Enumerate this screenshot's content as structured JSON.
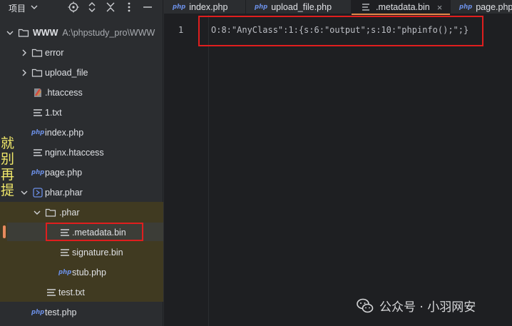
{
  "project_panel": {
    "title": "项目",
    "tree": [
      {
        "label": "WWW",
        "path": "A:\\phpstudy_pro\\WWW",
        "type": "folder",
        "expanded": true
      },
      {
        "label": "error",
        "type": "folder"
      },
      {
        "label": "upload_file",
        "type": "folder"
      },
      {
        "label": ".htaccess",
        "type": "htaccess"
      },
      {
        "label": "1.txt",
        "type": "text"
      },
      {
        "label": "index.php",
        "type": "php"
      },
      {
        "label": "nginx.htaccess",
        "type": "text"
      },
      {
        "label": "page.php",
        "type": "php"
      },
      {
        "label": "phar.phar",
        "type": "archive",
        "expanded": true
      },
      {
        "label": ".phar",
        "type": "folder",
        "expanded": true
      },
      {
        "label": ".metadata.bin",
        "type": "text",
        "selected": true
      },
      {
        "label": "signature.bin",
        "type": "text"
      },
      {
        "label": "stub.php",
        "type": "php"
      },
      {
        "label": "test.txt",
        "type": "text"
      },
      {
        "label": "test.php",
        "type": "php"
      }
    ]
  },
  "side_text": [
    "就",
    "别",
    "再",
    "提"
  ],
  "tabs": [
    {
      "label": "index.php",
      "icon": "php"
    },
    {
      "label": "upload_file.php",
      "icon": "php"
    },
    {
      "label": ".metadata.bin",
      "icon": "text",
      "active": true,
      "close": "×"
    },
    {
      "label": "page.php",
      "icon": "php"
    }
  ],
  "php_badge": "php",
  "editor": {
    "line_number": "1",
    "code": "O:8:\"AnyClass\":1:{s:6:\"output\";s:10:\"phpinfo();\";}"
  },
  "watermark": "公众号 · 小羽网安",
  "colors": {
    "accent": "#e58a4a",
    "highlight": "#e01e1e",
    "annotation_text": "#f0e86a"
  }
}
